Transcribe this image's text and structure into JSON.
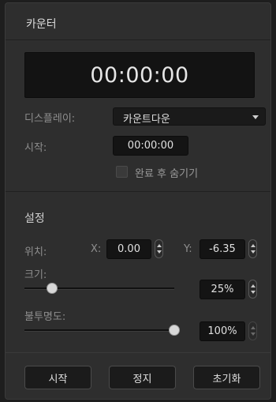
{
  "panel": {
    "title": "카운터"
  },
  "timer": {
    "display": "00:00:00"
  },
  "display_setting": {
    "label": "디스플레이:",
    "value": "카운트다운"
  },
  "start_time": {
    "label": "시작:",
    "value": "00:00:00"
  },
  "hide_when_done": {
    "label": "완료 후 숨기기",
    "checked": false
  },
  "settings": {
    "heading": "설정",
    "position": {
      "label": "위치:",
      "x_label": "X:",
      "x_value": "0.00",
      "y_label": "Y:",
      "y_value": "-6.35"
    },
    "size": {
      "label": "크기:",
      "value": "25%",
      "level_fraction": 0.12
    },
    "opacity": {
      "label": "불투명도:",
      "value": "100%",
      "level_fraction": 1.0
    }
  },
  "buttons": {
    "start": "시작",
    "stop": "정지",
    "reset": "초기화"
  }
}
